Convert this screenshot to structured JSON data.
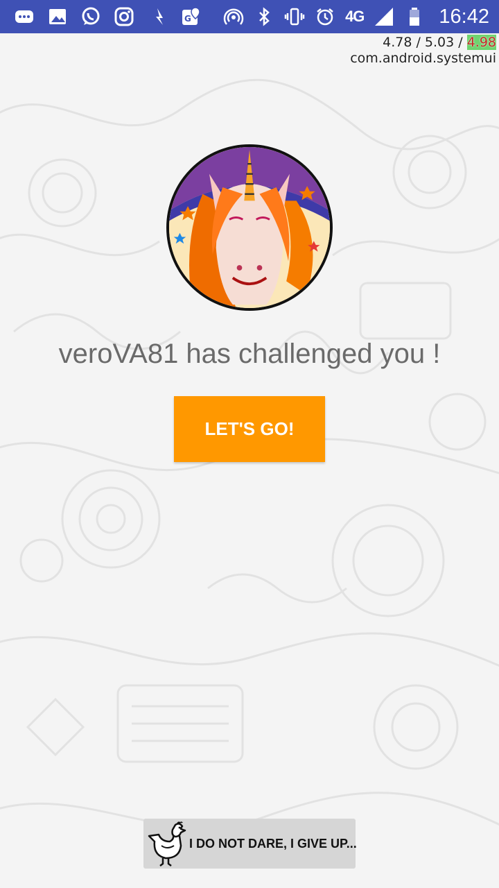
{
  "status_bar": {
    "left_icons": [
      "message-icon",
      "image-icon",
      "whatsapp-icon",
      "instagram-icon",
      "arrow-app-icon",
      "maps-icon"
    ],
    "right_icons": [
      "hotspot-icon",
      "bluetooth-icon",
      "vibrate-icon",
      "alarm-icon"
    ],
    "network": "4G",
    "time": "16:42"
  },
  "debug_overlay": {
    "load_prefix": "4.78 / 5.03 / ",
    "load_last": "4.98",
    "process": "com.android.systemui"
  },
  "challenge": {
    "avatar": "unicorn-avatar",
    "message": "veroVA81 has challenged you !",
    "go_label": "LET'S GO!",
    "give_up_label": "I DO NOT DARE, I GIVE UP..."
  },
  "colors": {
    "status_bar": "#3f51b5",
    "accent": "#ff9800",
    "background": "#f4f4f4",
    "secondary_button": "#d6d6d6"
  }
}
